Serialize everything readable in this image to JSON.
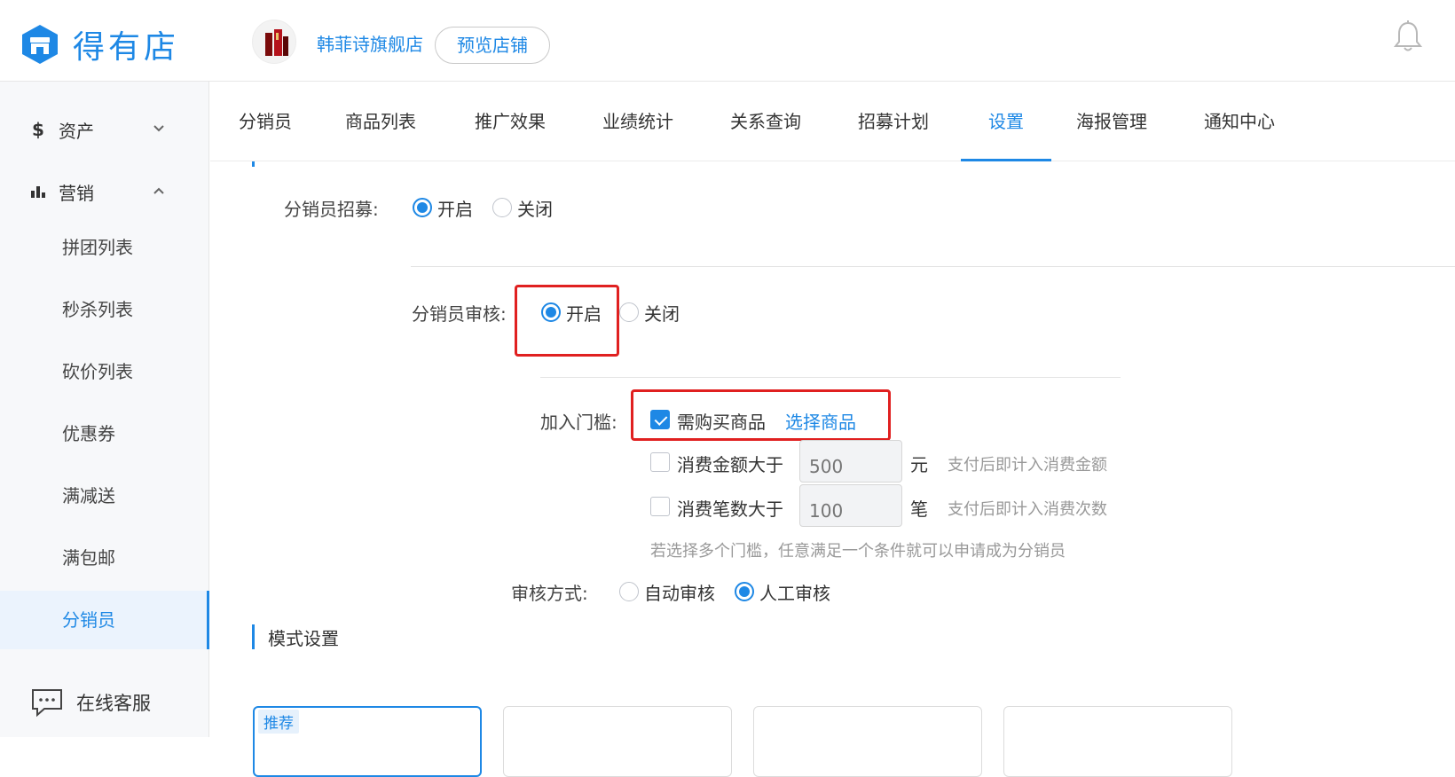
{
  "header": {
    "brand": "得有店",
    "shop_name": "韩菲诗旗舰店",
    "preview_label": "预览店铺"
  },
  "sidebar": {
    "assets": {
      "icon": "$",
      "label": "资产"
    },
    "marketing": {
      "label": "营销"
    },
    "items": [
      {
        "label": "拼团列表"
      },
      {
        "label": "秒杀列表"
      },
      {
        "label": "砍价列表"
      },
      {
        "label": "优惠券"
      },
      {
        "label": "满减送"
      },
      {
        "label": "满包邮"
      },
      {
        "label": "分销员"
      }
    ],
    "active_item": "分销员",
    "support_label": "在线客服"
  },
  "tabs": [
    {
      "label": "分销员"
    },
    {
      "label": "商品列表"
    },
    {
      "label": "推广效果"
    },
    {
      "label": "业绩统计"
    },
    {
      "label": "关系查询"
    },
    {
      "label": "招募计划"
    },
    {
      "label": "设置"
    },
    {
      "label": "海报管理"
    },
    {
      "label": "通知中心"
    }
  ],
  "active_tab": "设置",
  "form": {
    "recruit": {
      "label": "分销员招募:",
      "on": "开启",
      "off": "关闭",
      "selected": "开启"
    },
    "review": {
      "label": "分销员审核:",
      "on": "开启",
      "off": "关闭",
      "selected": "开启"
    },
    "threshold": {
      "label": "加入门槛:",
      "buy_product": {
        "label": "需购买商品",
        "checked": true,
        "link": "选择商品"
      },
      "amount": {
        "label": "消费金额大于",
        "placeholder": "500",
        "unit": "元",
        "hint": "支付后即计入消费金额",
        "checked": false
      },
      "count": {
        "label": "消费笔数大于",
        "placeholder": "100",
        "unit": "笔",
        "hint": "支付后即计入消费次数",
        "checked": false
      },
      "note": "若选择多个门槛，任意满足一个条件就可以申请成为分销员"
    },
    "review_mode": {
      "label": "审核方式:",
      "auto": "自动审核",
      "manual": "人工审核",
      "selected": "人工审核"
    }
  },
  "mode_section": {
    "title": "模式设置",
    "recommended_badge": "推荐"
  },
  "colors": {
    "accent": "#1e88e5",
    "highlight_box": "#e02020"
  }
}
